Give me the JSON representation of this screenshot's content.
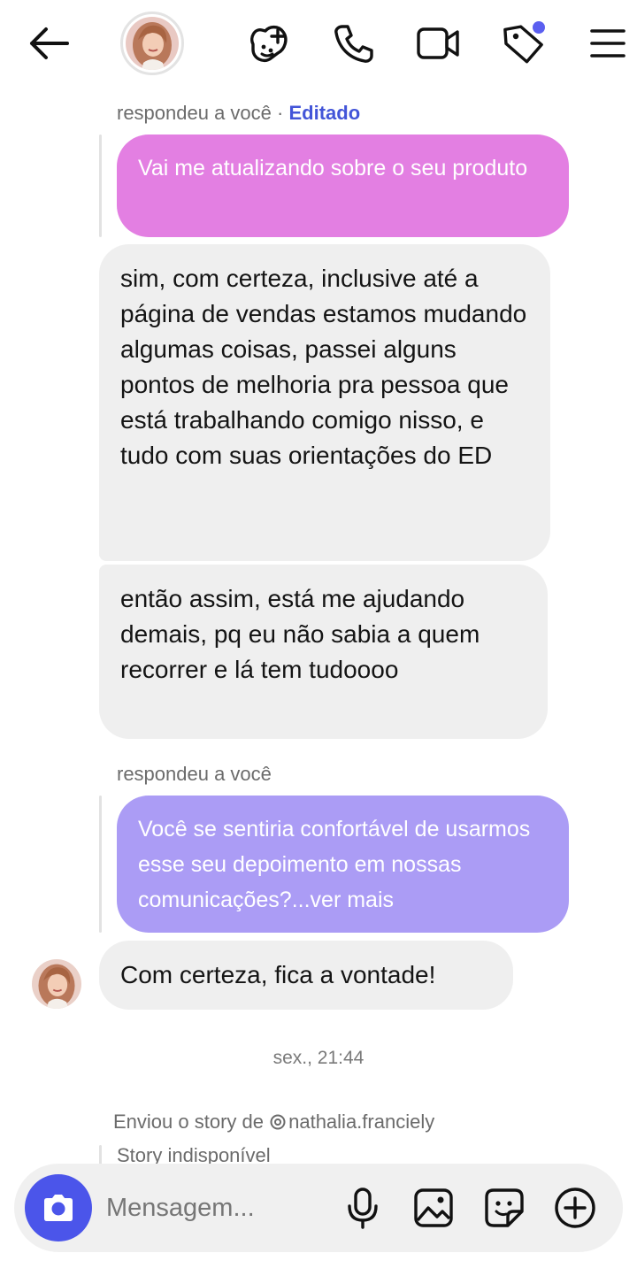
{
  "header": {
    "back_icon": "arrow-left-icon",
    "contact_avatar": "contact-avatar",
    "actions": [
      "games-icon",
      "phone-icon",
      "video-icon",
      "tag-icon",
      "menu-icon"
    ],
    "tag_badge_color": "#5b5ff0"
  },
  "thread": {
    "group1": {
      "meta": "respondeu a você · ",
      "meta_edited": "Editado",
      "quoted": "Vai me atualizando sobre o seu produto",
      "messages": [
        "sim, com certeza, inclusive até a página de vendas estamos mudando algumas coisas, passei alguns pontos de melhoria pra pessoa que está trabalhando comigo nisso, e tudo com suas orientações do ED",
        "então assim, está me ajudando demais, pq eu não sabia a quem recorrer e lá tem tudoooo"
      ]
    },
    "group2": {
      "meta": "respondeu a você",
      "quoted": "Você se sentiria confortável de usarmos esse seu depoimento em nossas comunicações?...ver mais",
      "message": "Com certeza, fica a vontade!"
    },
    "timestamp": "sex., 21:44",
    "story": {
      "meta": "Enviou o story de ",
      "handle": "nathalia.franciely",
      "status": "Story indisponível"
    }
  },
  "composer": {
    "placeholder": "Mensagem...",
    "icons": [
      "microphone-icon",
      "image-icon",
      "sticker-icon",
      "plus-icon"
    ],
    "camera_color": "#4b55ea"
  },
  "colors": {
    "quoted_pink": "#e37fe2",
    "quoted_purple": "#ab9cf5",
    "incoming": "#efefef",
    "accent": "#4355d8"
  }
}
